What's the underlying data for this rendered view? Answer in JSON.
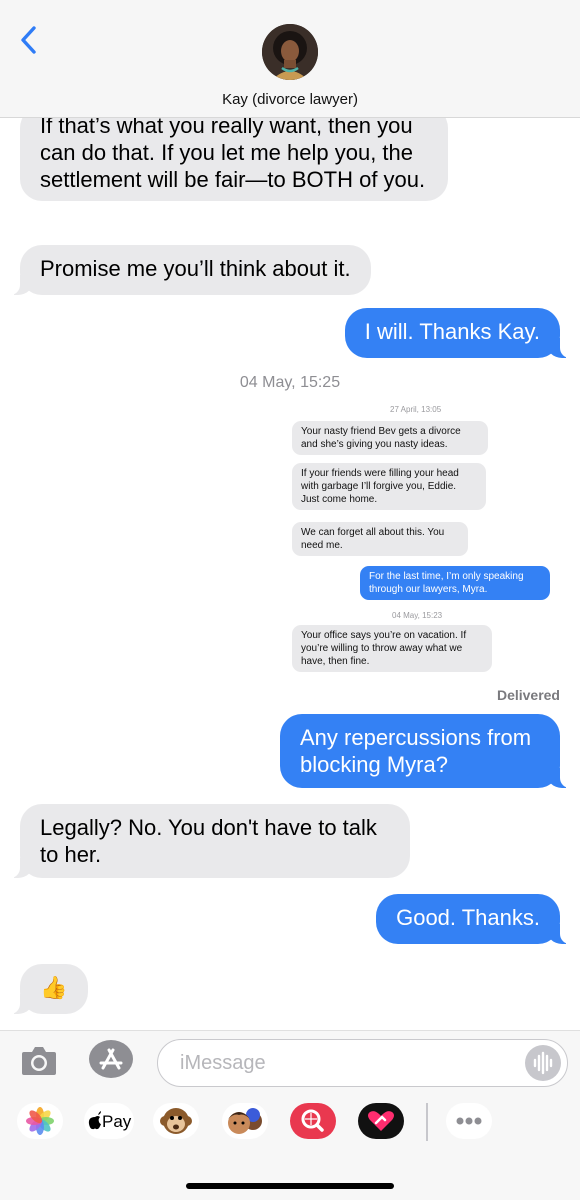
{
  "header": {
    "contact_name": "Kay (divorce lawyer)",
    "back_icon": "chevron-left-icon"
  },
  "messages": [
    {
      "id": "m1",
      "dir": "incoming",
      "text": "If that’s what you really want, then you can do that. If you let me help you, the settlement will be fair—to BOTH of you."
    },
    {
      "id": "m2",
      "dir": "incoming",
      "text": "Promise me you’ll think about it."
    },
    {
      "id": "m3",
      "dir": "outgoing",
      "text": "I will. Thanks Kay."
    },
    {
      "id": "m4",
      "dir": "outgoing",
      "text": "Any repercussions from blocking Myra?"
    },
    {
      "id": "m5",
      "dir": "incoming",
      "text": "Legally? No. You don't have to talk to her."
    },
    {
      "id": "m6",
      "dir": "outgoing",
      "text": "Good. Thanks."
    },
    {
      "id": "m7",
      "dir": "incoming",
      "text": "👍"
    }
  ],
  "timestamp": "04 May, 15:25",
  "delivered_label": "Delivered",
  "attachment": {
    "timestamp_1": "27 April, 13:05",
    "timestamp_2": "04 May, 15:23",
    "messages": [
      {
        "dir": "incoming",
        "text": "Your nasty friend Bev gets a divorce and she’s giving you nasty ideas."
      },
      {
        "dir": "incoming",
        "text": "If your friends were filling your head with garbage I’ll forgive you, Eddie. Just come home."
      },
      {
        "dir": "incoming",
        "text": "We can forget all about this. You need me."
      },
      {
        "dir": "outgoing",
        "text": "For the last time, I’m only speaking through our lawyers, Myra."
      },
      {
        "dir": "incoming",
        "text": "Your office says you’re on vacation. If you’re willing to throw away what we have, then fine."
      }
    ]
  },
  "input": {
    "placeholder": "iMessage",
    "camera_icon": "camera-icon",
    "appstore_icon": "app-store-icon",
    "mic_icon": "audio-waveform-icon"
  },
  "app_drawer": {
    "items": [
      "photos-icon",
      "apple-pay-icon",
      "monkey-memoji-icon",
      "memoji-icon",
      "image-search-icon",
      "digital-touch-icon",
      "more-icon"
    ],
    "pay_label": "Pay"
  },
  "colors": {
    "outgoing_bubble": "#3481f4",
    "incoming_bubble": "#e9e9eb",
    "ios_blue": "#2f7cf6"
  }
}
